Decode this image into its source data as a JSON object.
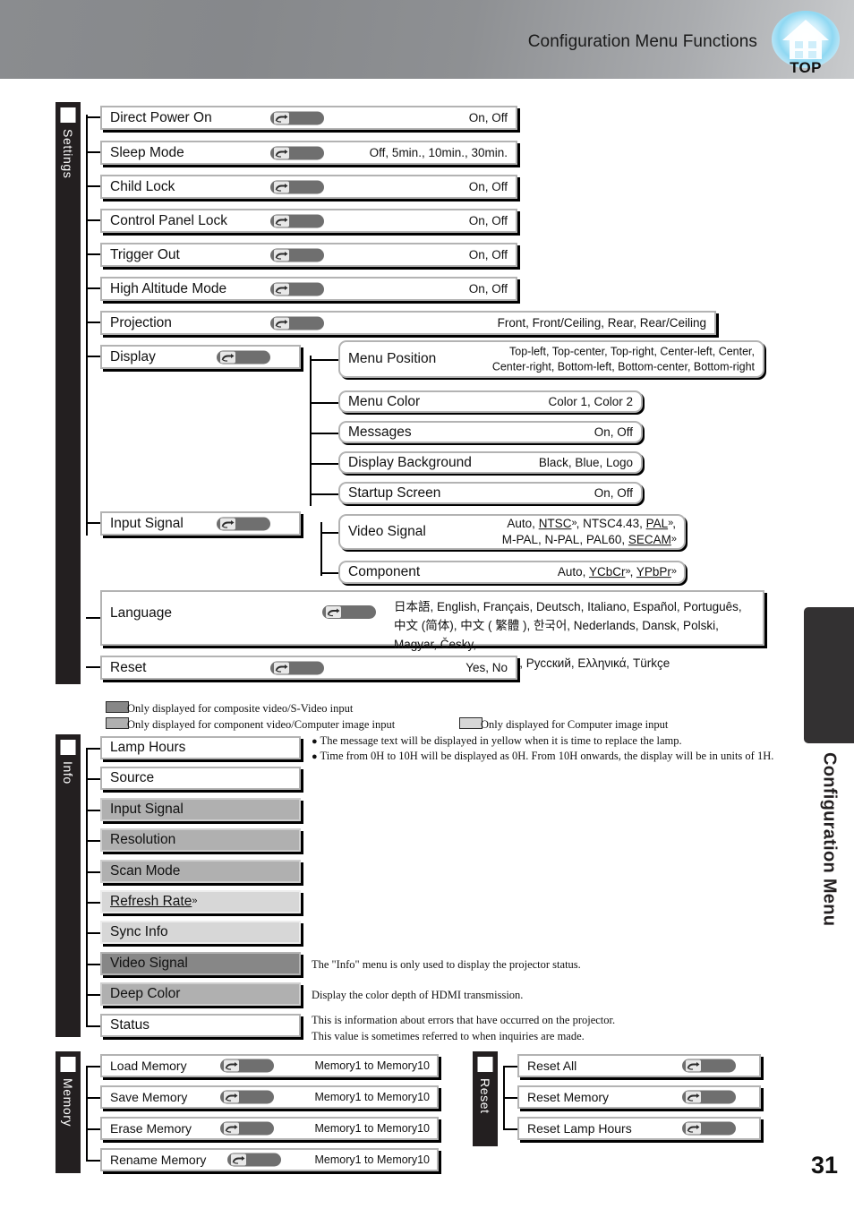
{
  "header": {
    "title": "Configuration Menu Functions",
    "logo_label": "TOP",
    "logo_icon": "home-icon"
  },
  "side_tab": {
    "label": "Configuration Menu"
  },
  "page_number": "31",
  "icons": {
    "hand": "pointing-hand-icon"
  },
  "groups": {
    "settings": {
      "tab_label": "Settings"
    },
    "info": {
      "tab_label": "Info"
    },
    "memory": {
      "tab_label": "Memory"
    },
    "reset": {
      "tab_label": "Reset"
    }
  },
  "settings_items": [
    {
      "label": "Direct Power On",
      "options": "On, Off"
    },
    {
      "label": "Sleep Mode",
      "options": "Off, 5min., 10min., 30min."
    },
    {
      "label": "Child Lock",
      "options": "On, Off"
    },
    {
      "label": "Control Panel Lock",
      "options": "On, Off"
    },
    {
      "label": "Trigger Out",
      "options": "On, Off"
    },
    {
      "label": "High Altitude Mode",
      "options": "On, Off"
    },
    {
      "label": "Projection",
      "options": "Front, Front/Ceiling, Rear, Rear/Ceiling"
    }
  ],
  "display": {
    "label": "Display",
    "children": [
      {
        "label": "Menu Position",
        "options_line1": "Top-left, Top-center, Top-right, Center-left, Center,",
        "options_line2": "Center-right, Bottom-left, Bottom-center, Bottom-right"
      },
      {
        "label": "Menu Color",
        "options": "Color 1, Color 2"
      },
      {
        "label": "Messages",
        "options": "On, Off"
      },
      {
        "label": "Display Background",
        "options": "Black, Blue, Logo"
      },
      {
        "label": "Startup Screen",
        "options": "On, Off"
      }
    ]
  },
  "input_signal": {
    "label": "Input Signal",
    "children": [
      {
        "label": "Video Signal",
        "line1_a": "Auto, ",
        "line1_ntsc": "NTSC",
        "line1_b": ", NTSC4.43, ",
        "line1_pal": "PAL",
        "line1_c": ",",
        "line2_a": "M-PAL, N-PAL, PAL60, ",
        "line2_secam": "SECAM"
      },
      {
        "label": "Component",
        "a": "Auto, ",
        "ycbcr": "YCbCr",
        "b": ", ",
        "ypbpr": "YPbPr"
      }
    ]
  },
  "language": {
    "label": "Language",
    "line1": "日本語, English, Français, Deutsch, Italiano, Español, Português,",
    "line2": "中文 (简体), 中文 ( 繁體 ), 한국어, Nederlands, Dansk, Polski, Magyar, Česky,",
    "line3": "Norsk, Svenska, Suomi, Русский, Ελληνικά, Türkçe"
  },
  "reset_row": {
    "label": "Reset",
    "options": "Yes, No"
  },
  "legend": [
    {
      "swatch": "#878787",
      "text": "Only displayed for composite video/S-Video input"
    },
    {
      "swatch": "#b0b0b0",
      "text": "Only displayed for component video/Computer image input"
    },
    {
      "swatch": "#d7d7d7",
      "text": "Only displayed for Computer image input"
    }
  ],
  "lamp_notes": [
    "The message text will be displayed in yellow when it is time to replace the lamp.",
    "Time from 0H to 10H will be displayed as 0H. From 10H onwards, the display will be in units of 1H."
  ],
  "info_items": [
    {
      "label": "Lamp Hours",
      "shade": "white",
      "desc": ""
    },
    {
      "label": "Source",
      "shade": "white",
      "desc": ""
    },
    {
      "label": "Input Signal",
      "shade": "gray-mid",
      "desc": ""
    },
    {
      "label": "Resolution",
      "shade": "gray-mid",
      "desc": ""
    },
    {
      "label": "Scan Mode",
      "shade": "gray-mid",
      "desc": ""
    },
    {
      "label": "Refresh Rate",
      "shade": "gray-light",
      "desc": "",
      "glossary": true
    },
    {
      "label": "Sync Info",
      "shade": "gray-light",
      "desc": ""
    },
    {
      "label": "Video Signal",
      "shade": "gray-dark",
      "desc": "The \"Info\" menu is only used to display the projector status."
    },
    {
      "label": "Deep Color",
      "shade": "gray-mid",
      "desc": "Display the color depth of HDMI transmission."
    },
    {
      "label": "Status",
      "shade": "white",
      "desc": "This is information about errors that have occurred on the projector.\nThis value is sometimes referred to when inquiries are made."
    }
  ],
  "memory_items": [
    {
      "label": "Load Memory",
      "options": "Memory1 to Memory10"
    },
    {
      "label": "Save Memory",
      "options": "Memory1 to Memory10"
    },
    {
      "label": "Erase Memory",
      "options": "Memory1 to Memory10"
    },
    {
      "label": "Rename Memory",
      "options": "Memory1 to Memory10"
    }
  ],
  "reset_items": [
    {
      "label": "Reset All"
    },
    {
      "label": "Reset Memory"
    },
    {
      "label": "Reset Lamp Hours"
    }
  ]
}
